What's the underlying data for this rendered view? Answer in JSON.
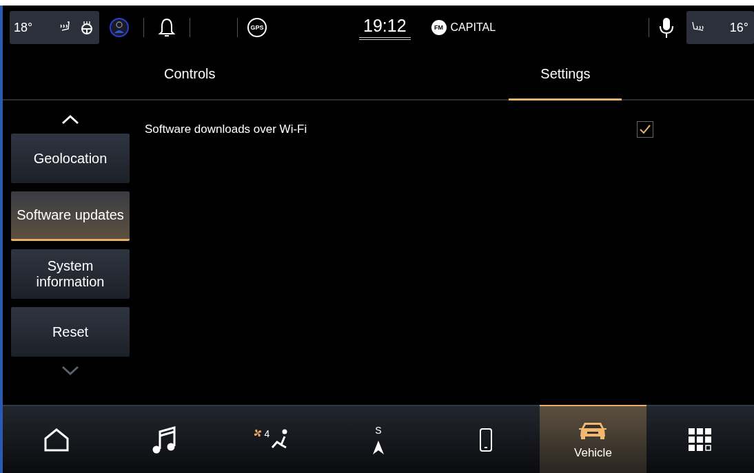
{
  "status_bar": {
    "left_temp": "18°",
    "gps_label": "GPS",
    "clock": "19:12",
    "radio": {
      "band": "FM",
      "station": "CAPITAL"
    },
    "right_temp": "16°"
  },
  "tabs": [
    {
      "label": "Controls",
      "selected": false
    },
    {
      "label": "Settings",
      "selected": true
    }
  ],
  "sidebar": {
    "items": [
      {
        "label": "Geolocation",
        "selected": false
      },
      {
        "label": "Software updates",
        "selected": true
      },
      {
        "label": "System information",
        "selected": false
      },
      {
        "label": "Reset",
        "selected": false
      }
    ]
  },
  "settings": [
    {
      "label": "Software downloads over Wi-Fi",
      "checked": true
    }
  ],
  "nav": [
    {
      "kind": "home",
      "selected": false
    },
    {
      "kind": "music",
      "selected": false
    },
    {
      "kind": "climate",
      "badge": "4",
      "selected": false
    },
    {
      "kind": "navigation",
      "badge": "S",
      "selected": false
    },
    {
      "kind": "phone",
      "selected": false
    },
    {
      "kind": "vehicle",
      "label": "Vehicle",
      "selected": true
    },
    {
      "kind": "apps",
      "selected": false
    }
  ]
}
